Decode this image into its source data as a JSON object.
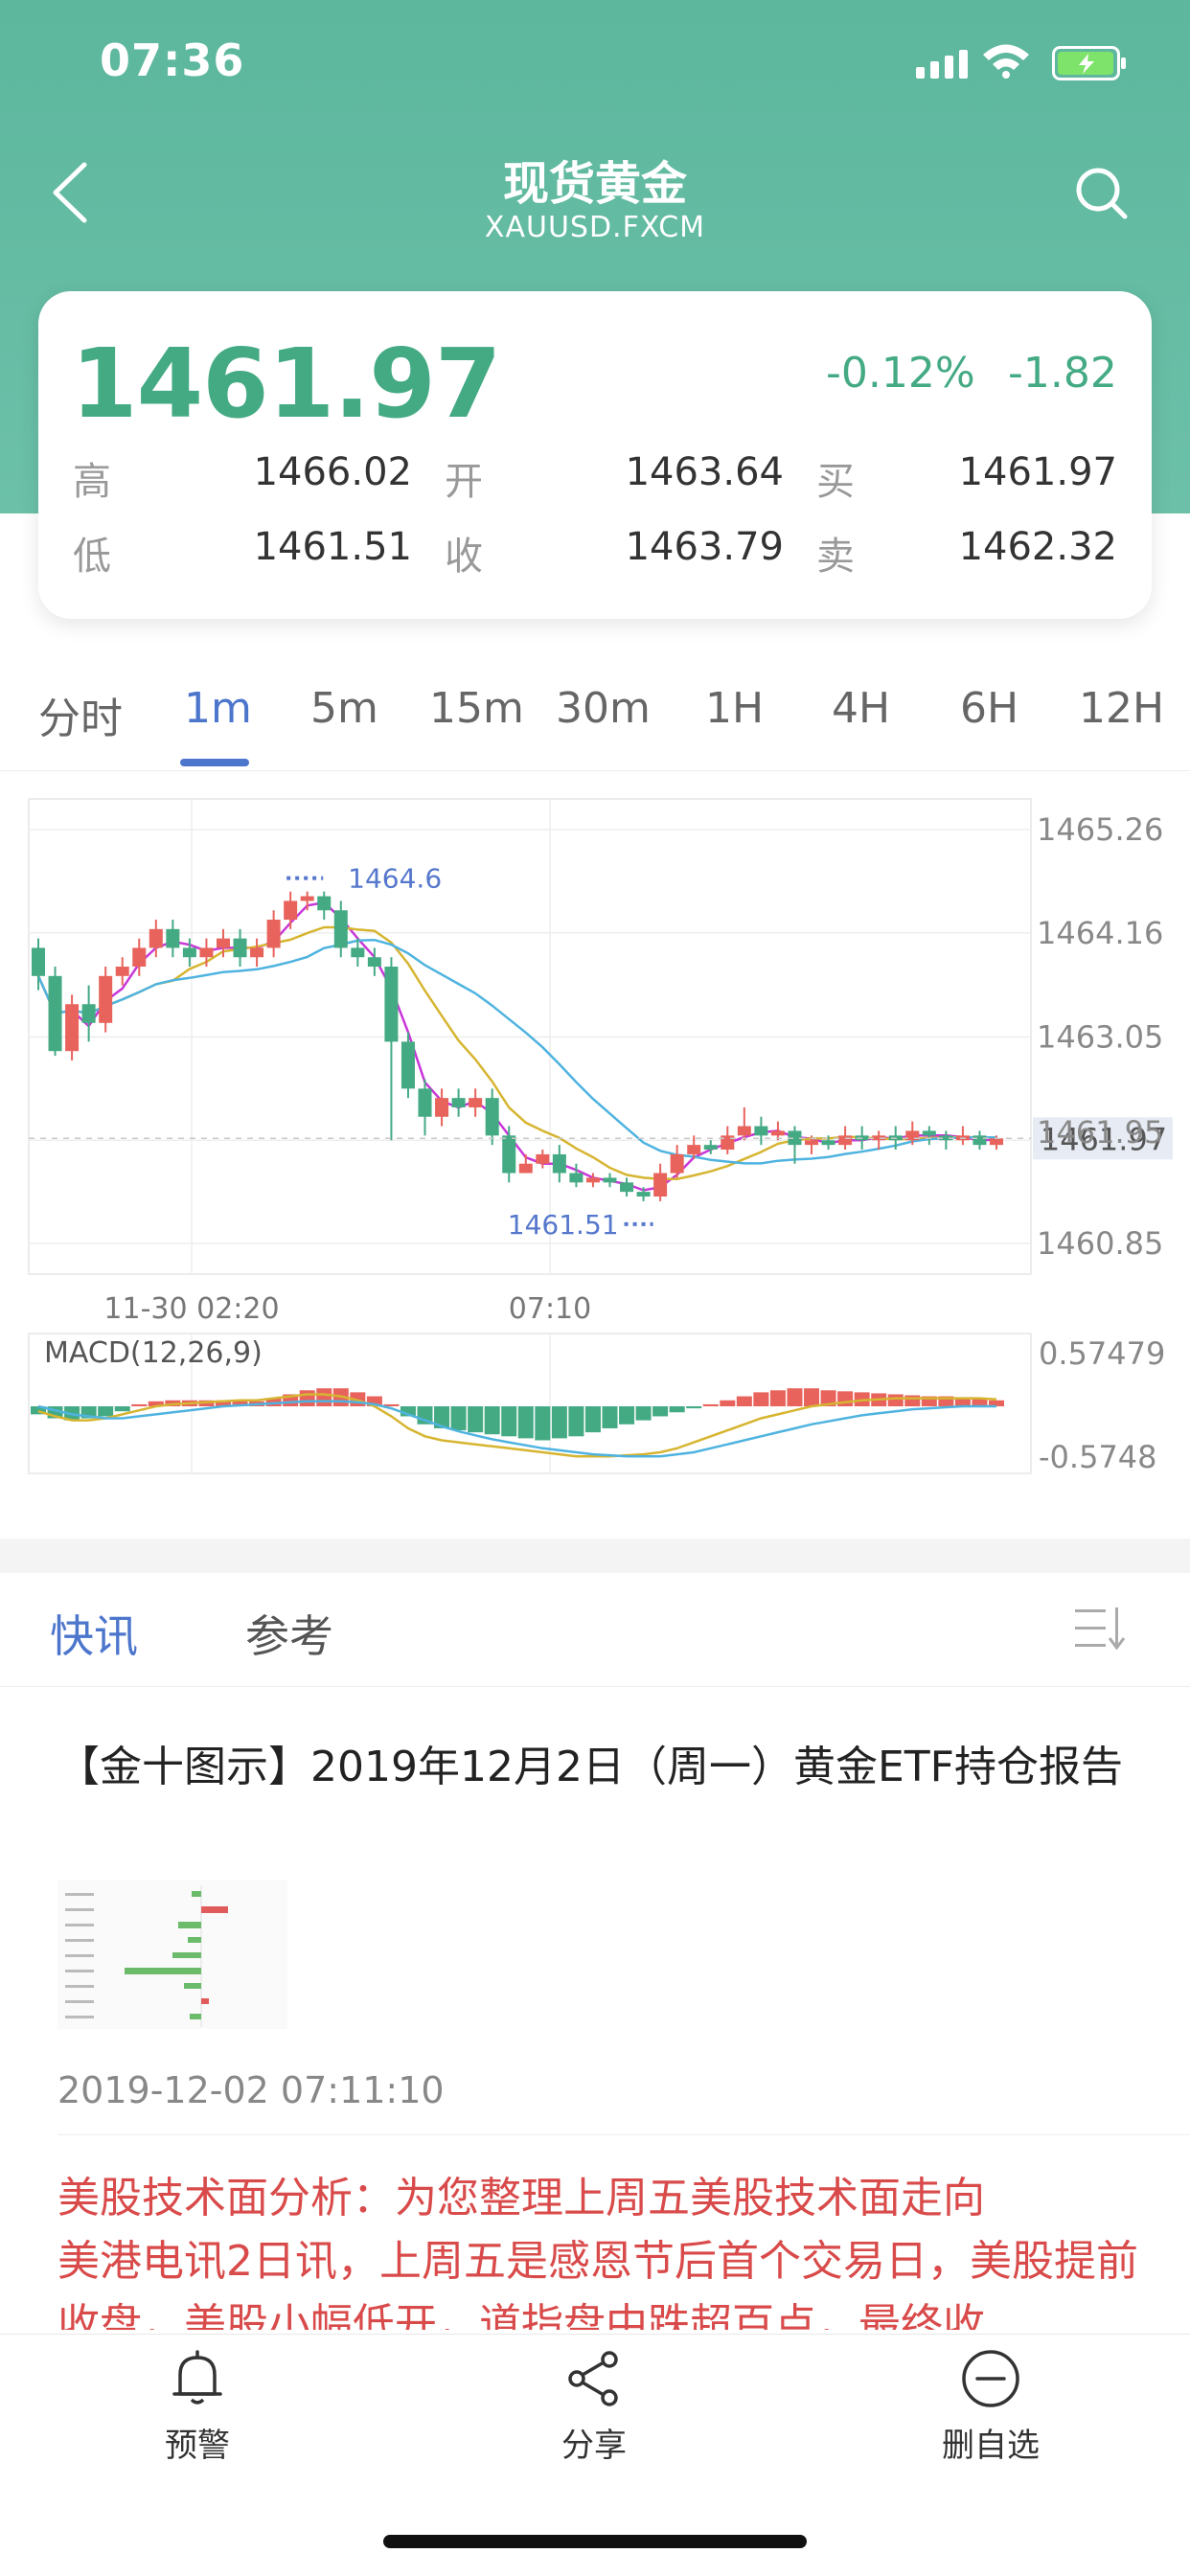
{
  "status_bar": {
    "time": "07:36"
  },
  "nav": {
    "title": "现货黄金",
    "subtitle": "XAUUSD.FXCM"
  },
  "quote": {
    "price": "1461.97",
    "change_pct": "-0.12%",
    "change": "-1.82",
    "labels": {
      "high": "高",
      "open": "开",
      "buy": "买",
      "low": "低",
      "close": "收",
      "sell": "卖"
    },
    "high": "1466.02",
    "open": "1463.64",
    "buy": "1461.97",
    "low": "1461.51",
    "close": "1463.79",
    "sell": "1462.32",
    "up_color": "#44aa84",
    "down_color": "#e8635c"
  },
  "periods": [
    "分时",
    "1m",
    "5m",
    "15m",
    "30m",
    "1H",
    "4H",
    "6H",
    "12H"
  ],
  "active_period": "1m",
  "chart_data": [
    {
      "type": "candlestick",
      "x_ticks": [
        "11-30 02:20",
        "07:10"
      ],
      "y_ticks": [
        "1465.26",
        "1464.16",
        "1463.05",
        "1461.95",
        "1460.85"
      ],
      "ylim": [
        1460.85,
        1465.26
      ],
      "current_price_label": "1461.97",
      "max_label": "1464.6",
      "min_label": "1461.51",
      "candles": [
        [
          1464.0,
          1463.7,
          1464.1,
          1463.55
        ],
        [
          1463.7,
          1462.9,
          1463.8,
          1462.85
        ],
        [
          1462.9,
          1463.4,
          1463.5,
          1462.8
        ],
        [
          1463.4,
          1463.2,
          1463.6,
          1463.0
        ],
        [
          1463.2,
          1463.7,
          1463.8,
          1463.1
        ],
        [
          1463.7,
          1463.8,
          1463.9,
          1463.6
        ],
        [
          1463.8,
          1464.0,
          1464.1,
          1463.7
        ],
        [
          1464.0,
          1464.2,
          1464.3,
          1463.9
        ],
        [
          1464.2,
          1464.0,
          1464.3,
          1463.9
        ],
        [
          1464.0,
          1463.9,
          1464.1,
          1463.8
        ],
        [
          1463.9,
          1464.0,
          1464.1,
          1463.8
        ],
        [
          1464.0,
          1464.1,
          1464.2,
          1463.9
        ],
        [
          1464.1,
          1463.9,
          1464.2,
          1463.8
        ],
        [
          1463.9,
          1464.0,
          1464.1,
          1463.8
        ],
        [
          1464.0,
          1464.3,
          1464.4,
          1463.9
        ],
        [
          1464.3,
          1464.5,
          1464.6,
          1464.2
        ],
        [
          1464.5,
          1464.55,
          1464.6,
          1464.4
        ],
        [
          1464.55,
          1464.4,
          1464.6,
          1464.3
        ],
        [
          1464.4,
          1464.0,
          1464.5,
          1463.9
        ],
        [
          1464.0,
          1463.9,
          1464.1,
          1463.8
        ],
        [
          1463.9,
          1463.8,
          1464.0,
          1463.7
        ],
        [
          1463.8,
          1463.0,
          1463.9,
          1461.95
        ],
        [
          1463.0,
          1462.5,
          1463.1,
          1462.4
        ],
        [
          1462.5,
          1462.2,
          1462.6,
          1462.0
        ],
        [
          1462.2,
          1462.4,
          1462.5,
          1462.1
        ],
        [
          1462.4,
          1462.3,
          1462.5,
          1462.2
        ],
        [
          1462.3,
          1462.4,
          1462.5,
          1462.2
        ],
        [
          1462.4,
          1462.0,
          1462.5,
          1461.9
        ],
        [
          1462.0,
          1461.6,
          1462.1,
          1461.5
        ],
        [
          1461.6,
          1461.7,
          1461.8,
          1461.6
        ],
        [
          1461.7,
          1461.8,
          1461.85,
          1461.65
        ],
        [
          1461.8,
          1461.6,
          1461.9,
          1461.5
        ],
        [
          1461.6,
          1461.5,
          1461.7,
          1461.45
        ],
        [
          1461.5,
          1461.55,
          1461.6,
          1461.45
        ],
        [
          1461.55,
          1461.5,
          1461.6,
          1461.45
        ],
        [
          1461.5,
          1461.4,
          1461.55,
          1461.35
        ],
        [
          1461.4,
          1461.35,
          1461.45,
          1461.3
        ],
        [
          1461.35,
          1461.6,
          1461.7,
          1461.3
        ],
        [
          1461.6,
          1461.8,
          1461.9,
          1461.55
        ],
        [
          1461.8,
          1461.9,
          1462.0,
          1461.75
        ],
        [
          1461.9,
          1461.85,
          1461.95,
          1461.8
        ],
        [
          1461.85,
          1462.0,
          1462.1,
          1461.8
        ],
        [
          1462.0,
          1462.1,
          1462.3,
          1461.95
        ],
        [
          1462.1,
          1462.0,
          1462.2,
          1461.9
        ],
        [
          1462.0,
          1462.05,
          1462.15,
          1461.95
        ],
        [
          1462.05,
          1461.9,
          1462.1,
          1461.7
        ],
        [
          1461.9,
          1461.95,
          1462.0,
          1461.8
        ],
        [
          1461.95,
          1461.9,
          1462.0,
          1461.85
        ],
        [
          1461.9,
          1462.0,
          1462.1,
          1461.85
        ],
        [
          1462.0,
          1461.95,
          1462.1,
          1461.85
        ],
        [
          1461.95,
          1462.0,
          1462.05,
          1461.85
        ],
        [
          1462.0,
          1461.95,
          1462.1,
          1461.85
        ],
        [
          1461.95,
          1462.05,
          1462.15,
          1461.9
        ],
        [
          1462.05,
          1462.0,
          1462.1,
          1461.9
        ],
        [
          1462.0,
          1461.95,
          1462.05,
          1461.85
        ],
        [
          1461.95,
          1462.0,
          1462.1,
          1461.9
        ],
        [
          1462.0,
          1461.9,
          1462.05,
          1461.85
        ],
        [
          1461.9,
          1461.97,
          1462.0,
          1461.85
        ]
      ],
      "ma_colors": [
        "#c837d8",
        "#d6b531",
        "#4fb3e0"
      ]
    },
    {
      "type": "bar",
      "title": "MACD(12,26,9)",
      "y_ticks": [
        "0.57479",
        "-0.5748"
      ],
      "ylim": [
        -0.5748,
        0.57479
      ],
      "histogram": [
        -0.08,
        -0.12,
        -0.14,
        -0.12,
        -0.1,
        -0.05,
        0.02,
        0.05,
        0.06,
        0.06,
        0.06,
        0.06,
        0.06,
        0.05,
        0.08,
        0.12,
        0.16,
        0.18,
        0.18,
        0.14,
        0.1,
        0.02,
        -0.1,
        -0.18,
        -0.22,
        -0.24,
        -0.26,
        -0.28,
        -0.3,
        -0.32,
        -0.34,
        -0.32,
        -0.3,
        -0.26,
        -0.22,
        -0.18,
        -0.14,
        -0.1,
        -0.06,
        -0.02,
        0.02,
        0.06,
        0.1,
        0.14,
        0.16,
        0.18,
        0.18,
        0.16,
        0.15,
        0.14,
        0.13,
        0.12,
        0.11,
        0.1,
        0.1,
        0.09,
        0.08,
        0.06
      ],
      "dif": [
        -0.05,
        -0.1,
        -0.14,
        -0.14,
        -0.12,
        -0.08,
        -0.04,
        0.0,
        0.02,
        0.03,
        0.04,
        0.05,
        0.06,
        0.06,
        0.08,
        0.1,
        0.12,
        0.12,
        0.1,
        0.06,
        0.0,
        -0.1,
        -0.22,
        -0.3,
        -0.34,
        -0.36,
        -0.38,
        -0.4,
        -0.42,
        -0.44,
        -0.46,
        -0.48,
        -0.5,
        -0.5,
        -0.5,
        -0.49,
        -0.48,
        -0.46,
        -0.42,
        -0.36,
        -0.3,
        -0.24,
        -0.18,
        -0.12,
        -0.08,
        -0.04,
        0.0,
        0.02,
        0.04,
        0.06,
        0.07,
        0.08,
        0.08,
        0.08,
        0.08,
        0.08,
        0.08,
        0.07
      ],
      "dea": [
        0.0,
        -0.04,
        -0.08,
        -0.1,
        -0.12,
        -0.12,
        -0.1,
        -0.08,
        -0.06,
        -0.04,
        -0.02,
        0.0,
        0.01,
        0.02,
        0.03,
        0.04,
        0.05,
        0.05,
        0.05,
        0.04,
        0.02,
        -0.02,
        -0.08,
        -0.14,
        -0.2,
        -0.25,
        -0.29,
        -0.33,
        -0.36,
        -0.39,
        -0.42,
        -0.44,
        -0.46,
        -0.48,
        -0.49,
        -0.5,
        -0.5,
        -0.5,
        -0.48,
        -0.46,
        -0.42,
        -0.38,
        -0.34,
        -0.3,
        -0.26,
        -0.22,
        -0.18,
        -0.15,
        -0.12,
        -0.09,
        -0.07,
        -0.05,
        -0.03,
        -0.02,
        -0.01,
        0.0,
        0.0,
        0.0
      ],
      "dif_color": "#d6b531",
      "dea_color": "#4fb3e0"
    }
  ],
  "news_tabs": [
    "快讯",
    "参考"
  ],
  "news": [
    {
      "title": "【金十图示】2019年12月2日（周一）黄金ETF持仓报告",
      "time": "2019-12-02 07:11:10"
    },
    {
      "title": "美股技术面分析：为您整理上周五美股技术面走向",
      "body": "美港电讯2日讯，上周五是感恩节后首个交易日，美股提前收盘，美股小幅低开，道指盘中跌超百点，最终收"
    }
  ],
  "bottom_bar": [
    "预警",
    "分享",
    "删自选"
  ]
}
